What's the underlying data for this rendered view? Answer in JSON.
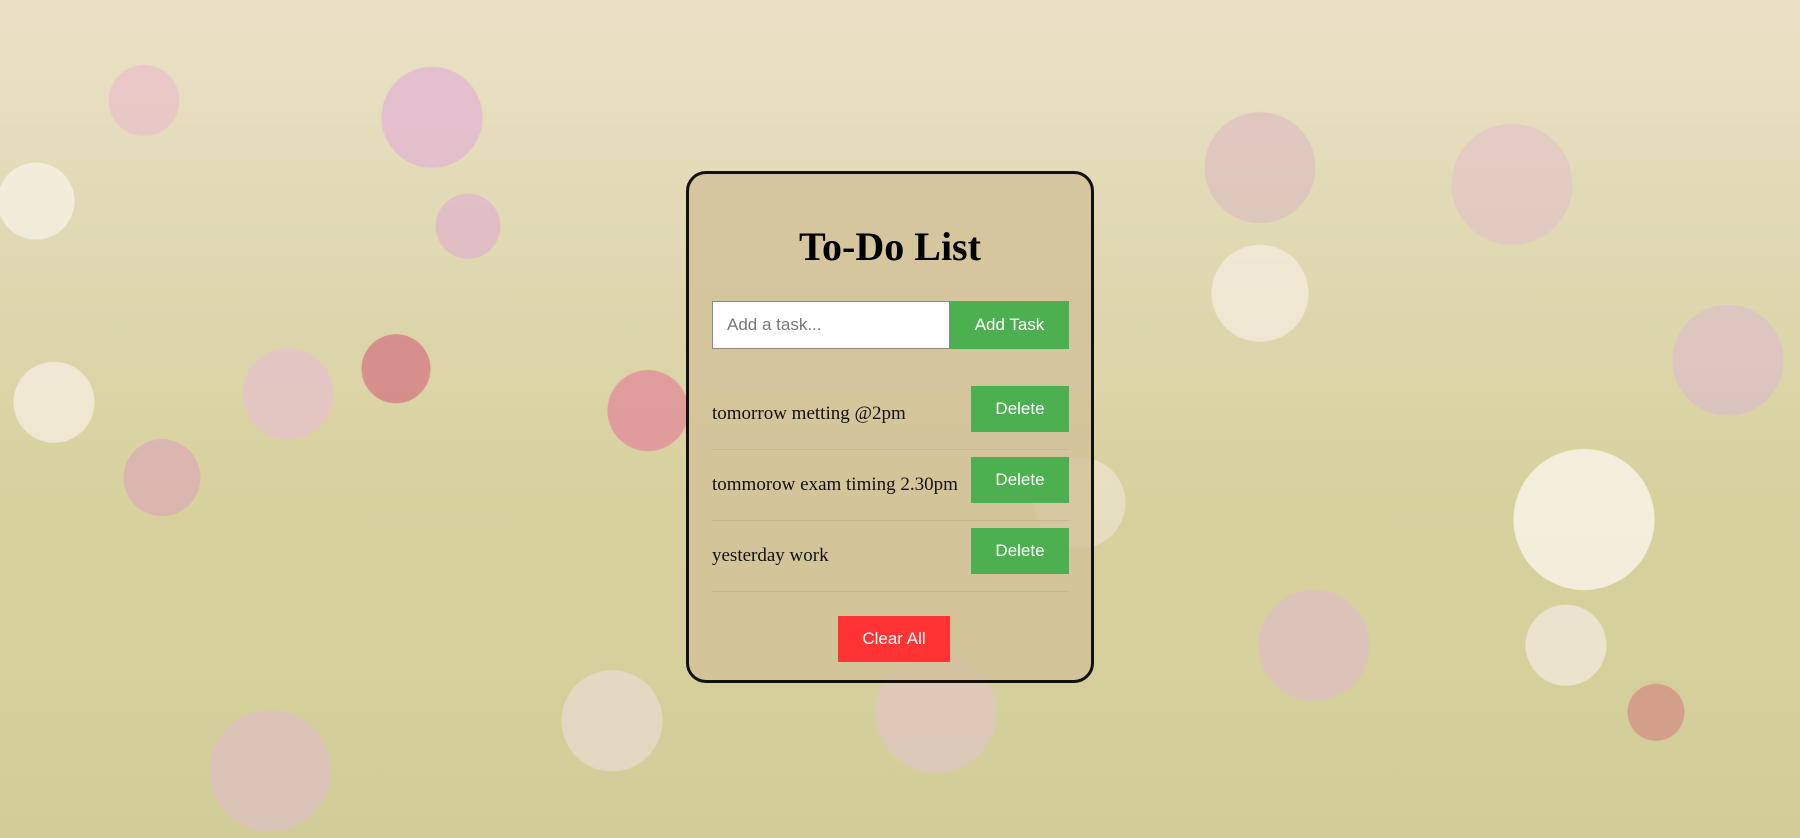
{
  "app": {
    "title": "To-Do List"
  },
  "input": {
    "placeholder": "Add a task...",
    "value": ""
  },
  "add_button": {
    "label": "Add Task"
  },
  "tasks": [
    {
      "text": "tomorrow metting @2pm",
      "delete_label": "Delete"
    },
    {
      "text": "tommorow exam timing 2.30pm",
      "delete_label": "Delete"
    },
    {
      "text": "yesterday work",
      "delete_label": "Delete"
    }
  ],
  "clear_button": {
    "label": "Clear All"
  },
  "colors": {
    "primary_button": "#4caf50",
    "danger_button": "#ff3333",
    "card_border": "#111111"
  }
}
